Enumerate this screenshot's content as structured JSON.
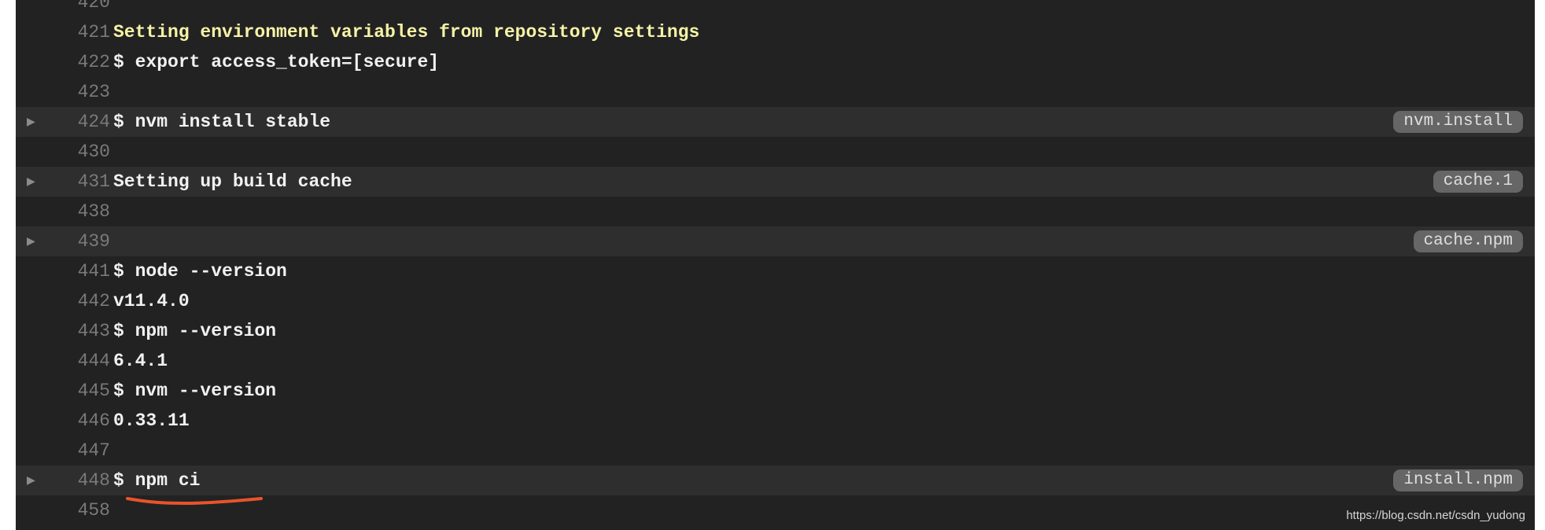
{
  "log": {
    "lines": [
      {
        "num": "420",
        "text": ""
      },
      {
        "num": "421",
        "text": "Setting environment variables from repository settings"
      },
      {
        "num": "422",
        "text": "$ export access_token=[secure]"
      },
      {
        "num": "423",
        "text": ""
      },
      {
        "num": "424",
        "text": "$ nvm install stable",
        "tag": "nvm.install"
      },
      {
        "num": "430",
        "text": ""
      },
      {
        "num": "431",
        "text": "Setting up build cache",
        "tag": "cache.1"
      },
      {
        "num": "438",
        "text": ""
      },
      {
        "num": "439",
        "text": "",
        "tag": "cache.npm"
      },
      {
        "num": "441",
        "text": "$ node --version"
      },
      {
        "num": "442",
        "text": "v11.4.0"
      },
      {
        "num": "443",
        "text": "$ npm --version"
      },
      {
        "num": "444",
        "text": "6.4.1"
      },
      {
        "num": "445",
        "text": "$ nvm --version"
      },
      {
        "num": "446",
        "text": "0.33.11"
      },
      {
        "num": "447",
        "text": ""
      },
      {
        "num": "448",
        "text": "$ npm ci",
        "tag": "install.npm"
      },
      {
        "num": "458",
        "text": ""
      }
    ]
  },
  "watermark": "https://blog.csdn.net/csdn_yudong",
  "colors": {
    "background": "#222222",
    "fold_row": "#2e2e2e",
    "highlight_text": "#f6f3a7",
    "tag_bg": "#666666",
    "annotation": "#e8542a"
  }
}
